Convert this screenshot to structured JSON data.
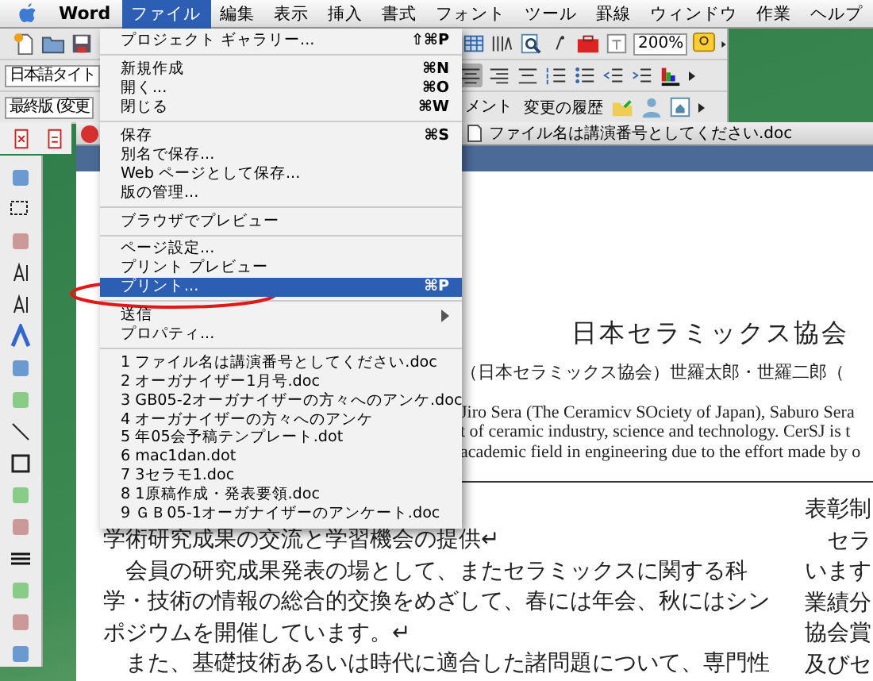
{
  "menubar": {
    "app": "Word",
    "items": [
      {
        "label": "ファイル",
        "selected": true
      },
      {
        "label": "編集",
        "selected": false
      },
      {
        "label": "表示",
        "selected": false
      },
      {
        "label": "挿入",
        "selected": false
      },
      {
        "label": "書式",
        "selected": false
      },
      {
        "label": "フォント",
        "selected": false
      },
      {
        "label": "ツール",
        "selected": false
      },
      {
        "label": "罫線",
        "selected": false
      },
      {
        "label": "ウィンドウ",
        "selected": false
      },
      {
        "label": "作業",
        "selected": false
      },
      {
        "label": "ヘルプ",
        "selected": false
      }
    ]
  },
  "toolbars": {
    "zoom": "200%",
    "style_dropdown": "日本語タイト",
    "view_dropdown": "最終版 (変更",
    "comment_dropdown": "メント",
    "track_changes": "変更の履歴"
  },
  "file_menu": [
    {
      "kind": "item",
      "label": "プロジェクト ギャラリー...",
      "shortcut": "⇧⌘P",
      "selected": false
    },
    {
      "kind": "separator"
    },
    {
      "kind": "item",
      "label": "新規作成",
      "shortcut": "⌘N",
      "selected": false
    },
    {
      "kind": "item",
      "label": "開く...",
      "shortcut": "⌘O",
      "selected": false
    },
    {
      "kind": "item",
      "label": "閉じる",
      "shortcut": "⌘W",
      "selected": false
    },
    {
      "kind": "separator"
    },
    {
      "kind": "item",
      "label": "保存",
      "shortcut": "⌘S",
      "selected": false
    },
    {
      "kind": "item",
      "label": "別名で保存...",
      "selected": false
    },
    {
      "kind": "item",
      "label": "Web ページとして保存...",
      "selected": false
    },
    {
      "kind": "item",
      "label": "版の管理...",
      "selected": false
    },
    {
      "kind": "separator"
    },
    {
      "kind": "item",
      "label": "ブラウザでプレビュー",
      "selected": false
    },
    {
      "kind": "separator"
    },
    {
      "kind": "item",
      "label": "ページ設定...",
      "selected": false
    },
    {
      "kind": "item",
      "label": "プリント プレビュー",
      "selected": false
    },
    {
      "kind": "item",
      "label": "プリント...",
      "shortcut": "⌘P",
      "selected": true
    },
    {
      "kind": "separator"
    },
    {
      "kind": "submenu",
      "label": "送信",
      "selected": false
    },
    {
      "kind": "item",
      "label": "プロパティ...",
      "selected": false
    },
    {
      "kind": "separator"
    },
    {
      "kind": "item",
      "label": "1 ファイル名は講演番号としてください.doc",
      "selected": false
    },
    {
      "kind": "item",
      "label": "2 オーガナイザー1月号.doc",
      "selected": false
    },
    {
      "kind": "item",
      "label": "3 GB05-2オーガナイザーの方々へのアンケ.doc",
      "selected": false
    },
    {
      "kind": "item",
      "label": "4 オーガナイザーの方々へのアンケ",
      "selected": false
    },
    {
      "kind": "item",
      "label": "5 年05会予稿テンプレート.dot",
      "selected": false
    },
    {
      "kind": "item",
      "label": "6 mac1dan.dot",
      "selected": false
    },
    {
      "kind": "item",
      "label": "7 3セラモ1.doc",
      "selected": false
    },
    {
      "kind": "item",
      "label": "8 1原稿作成・発表要領.doc",
      "selected": false
    },
    {
      "kind": "item",
      "label": "9 ＧＢ05-1オーガナイザーのアンケート.doc",
      "selected": false
    }
  ],
  "document": {
    "window_title": "ファイル名は講演番号としてください.doc",
    "title": "日本セラミックス協会",
    "authors": "（日本セラミックス協会）世羅太郎・世羅二郎（",
    "abstract_lines": [
      "Jiro Sera (The Ceramicv SOciety of Japan), Saburo Sera",
      "t of ceramic industry, science and technology. CerSJ is t",
      "academic field in engineering due to the effort made by o"
    ],
    "left_column": [
      "学術研究成果の交流と学習機会の提供↵",
      "　会員の研究成果発表の場として、またセラミックスに関する科",
      "学・技術の情報の総合的交換をめざして、春には年会、秋にはシン",
      "ポジウムを開催しています。↵",
      "　また、基礎技術あるいは時代に適合した諸問題について、専門性"
    ],
    "right_column": [
      "表彰制",
      "　セラ",
      "います",
      "業績分",
      "協会賞",
      "及びセ"
    ]
  }
}
